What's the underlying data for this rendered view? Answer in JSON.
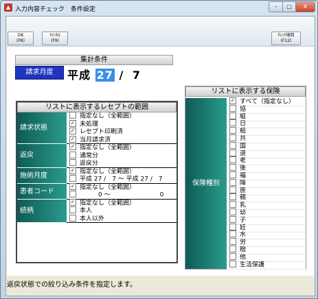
{
  "window": {
    "title": "入力内容チェック　条件設定",
    "min": "–",
    "max": "□",
    "close": "x"
  },
  "toolbar": {
    "ok": [
      "OK",
      "(F8)"
    ],
    "cancel": [
      "ｷｬﾝｾﾙ",
      "(F9)"
    ],
    "check": [
      "ﾁｪｯｸ項目",
      "(F12)"
    ]
  },
  "aggregation": {
    "header": "集計条件",
    "label": "請求月度",
    "era": "平成",
    "year": "27",
    "slash": "/",
    "month": "7"
  },
  "receipt_range": {
    "header": "リストに表示するレセプトの範囲",
    "groups": [
      {
        "label": "請求状態",
        "items": [
          {
            "text": "指定なし（全範囲）",
            "checked": false
          },
          {
            "text": "未処理",
            "checked": true
          },
          {
            "text": "レセプト印刷済",
            "checked": true
          },
          {
            "text": "当月請求済",
            "checked": true
          }
        ]
      },
      {
        "label": "返戻",
        "items": [
          {
            "text": "指定なし（全範囲）",
            "checked": true
          },
          {
            "text": "通常分",
            "checked": false
          },
          {
            "text": "返戻分",
            "checked": false
          }
        ]
      },
      {
        "label": "施術月度",
        "items": [
          {
            "text": "指定なし（全範囲）",
            "checked": true
          },
          {
            "text": "平成 27 /　7 ～ 平成 27 /　7",
            "checked": false
          }
        ]
      },
      {
        "label": "患者コード",
        "items": [
          {
            "text": "指定なし（全範囲）",
            "checked": true
          },
          {
            "text": "　　　0 ～　　　　　　　　0",
            "checked": false
          }
        ]
      },
      {
        "label": "続柄",
        "items": [
          {
            "text": "指定なし（全範囲）",
            "checked": true
          },
          {
            "text": "本人",
            "checked": false
          },
          {
            "text": "本人以外",
            "checked": false
          }
        ]
      }
    ]
  },
  "insurance": {
    "header": "リストに表示する保険",
    "label": "保険種別",
    "items": [
      {
        "text": "すべて（指定なし）",
        "checked": true
      },
      {
        "text": "協",
        "checked": false
      },
      {
        "text": "組",
        "checked": false
      },
      {
        "text": "日",
        "checked": false
      },
      {
        "text": "船",
        "checked": false
      },
      {
        "text": "共",
        "checked": false
      },
      {
        "text": "国",
        "checked": false
      },
      {
        "text": "退",
        "checked": false
      },
      {
        "text": "老",
        "checked": false
      },
      {
        "text": "後",
        "checked": false
      },
      {
        "text": "福",
        "checked": false
      },
      {
        "text": "障",
        "checked": false
      },
      {
        "text": "原",
        "checked": false
      },
      {
        "text": "親",
        "checked": false
      },
      {
        "text": "乳",
        "checked": false
      },
      {
        "text": "幼",
        "checked": false
      },
      {
        "text": "子",
        "checked": false
      },
      {
        "text": "妊",
        "checked": false
      },
      {
        "text": "水",
        "checked": false
      },
      {
        "text": "労",
        "checked": false
      },
      {
        "text": "賠",
        "checked": false
      },
      {
        "text": "他",
        "checked": false
      },
      {
        "text": "生活保護",
        "checked": false
      }
    ]
  },
  "status": "返戻状態での絞り込み条件を指定します。"
}
